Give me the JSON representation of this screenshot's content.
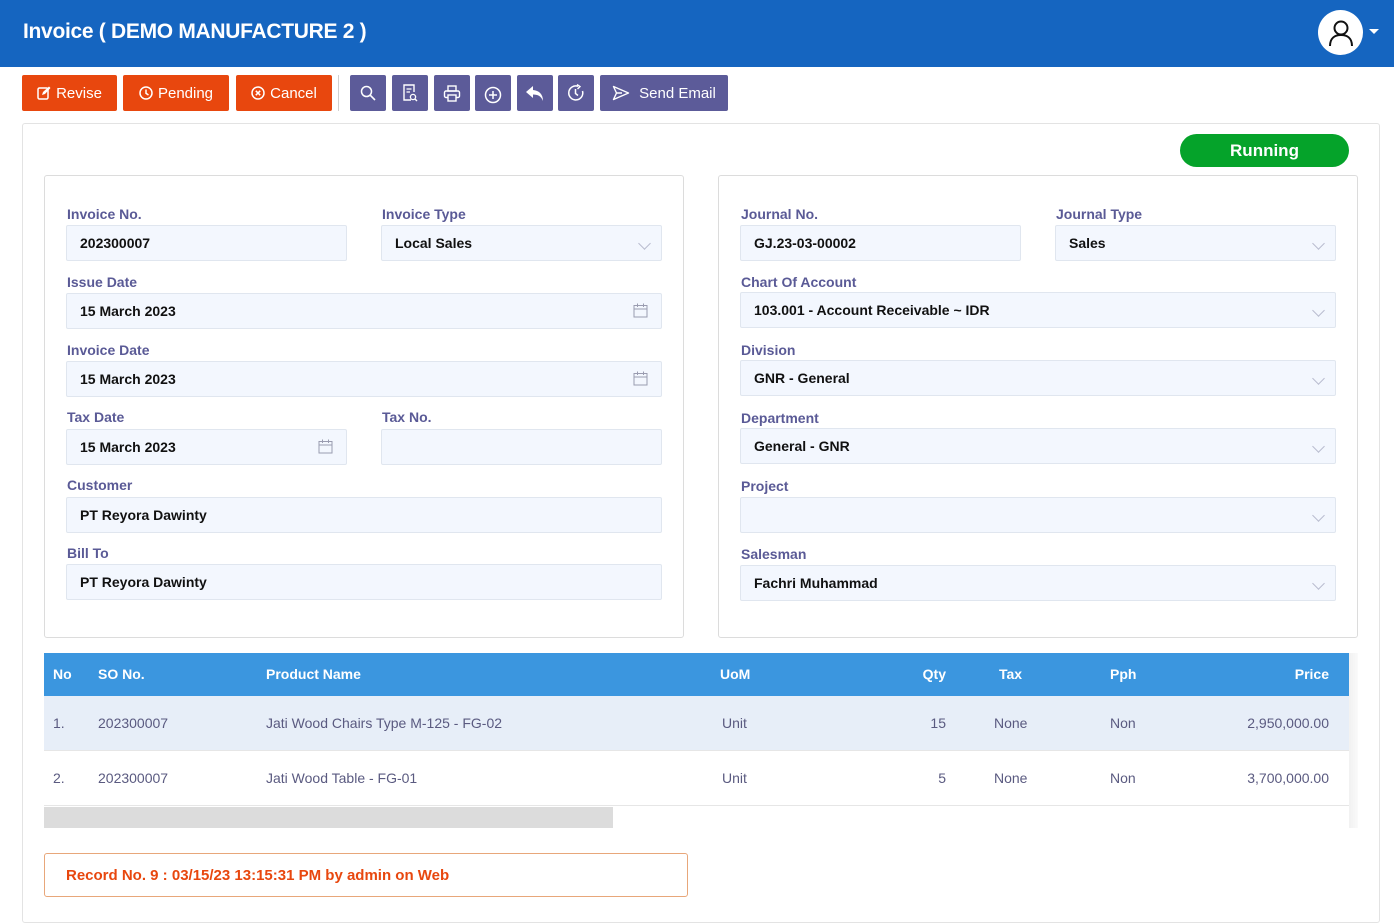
{
  "header": {
    "title": "Invoice ( DEMO MANUFACTURE 2 )",
    "user_icon": "user-icon",
    "dropdown_icon": "caret-down-icon"
  },
  "toolbar": {
    "revise_label": "Revise",
    "pending_label": "Pending",
    "cancel_label": "Cancel",
    "send_email_label": "Send Email",
    "icons": [
      "edit-icon",
      "clock-icon",
      "cancel-circle-icon",
      "search-icon",
      "preview-document-icon",
      "print-icon",
      "add-circle-icon",
      "undo-icon",
      "history-icon",
      "send-icon"
    ],
    "colors": {
      "action": "#e8470e",
      "tool": "#5c5b99"
    }
  },
  "status": {
    "label": "Running",
    "color": "#05a32a"
  },
  "left_form": {
    "invoice_no": {
      "label": "Invoice No.",
      "value": "202300007"
    },
    "invoice_type": {
      "label": "Invoice Type",
      "value": "Local Sales"
    },
    "issue_date": {
      "label": "Issue Date",
      "value": "15 March 2023"
    },
    "invoice_date": {
      "label": "Invoice Date",
      "value": "15 March 2023"
    },
    "tax_date": {
      "label": "Tax Date",
      "value": "15 March 2023"
    },
    "tax_no": {
      "label": "Tax No.",
      "value": ""
    },
    "customer": {
      "label": "Customer",
      "value": "PT Reyora Dawinty"
    },
    "bill_to": {
      "label": "Bill To",
      "value": "PT Reyora Dawinty"
    }
  },
  "right_form": {
    "journal_no": {
      "label": "Journal No.",
      "value": "GJ.23-03-00002"
    },
    "journal_type": {
      "label": "Journal Type",
      "value": "Sales"
    },
    "chart_of_account": {
      "label": "Chart Of Account",
      "value": "103.001 - Account Receivable ~ IDR"
    },
    "division": {
      "label": "Division",
      "value": "GNR - General"
    },
    "department": {
      "label": "Department",
      "value": "General - GNR"
    },
    "project": {
      "label": "Project",
      "value": ""
    },
    "salesman": {
      "label": "Salesman",
      "value": "Fachri Muhammad"
    }
  },
  "table": {
    "columns": [
      "No",
      "SO No.",
      "Product Name",
      "UoM",
      "Qty",
      "Tax",
      "Pph",
      "Price"
    ],
    "rows": [
      {
        "no": "1.",
        "so_no": "202300007",
        "product": "Jati Wood Chairs Type M-125 - FG-02",
        "uom": "Unit",
        "qty": "15",
        "tax": "None",
        "pph": "Non",
        "price": "2,950,000.00"
      },
      {
        "no": "2.",
        "so_no": "202300007",
        "product": "Jati Wood Table - FG-01",
        "uom": "Unit",
        "qty": "5",
        "tax": "None",
        "pph": "Non",
        "price": "3,700,000.00"
      }
    ],
    "header_color": "#3b96df"
  },
  "record": {
    "text": "Record No. 9 : 03/15/23 13:15:31 PM by admin on Web"
  }
}
